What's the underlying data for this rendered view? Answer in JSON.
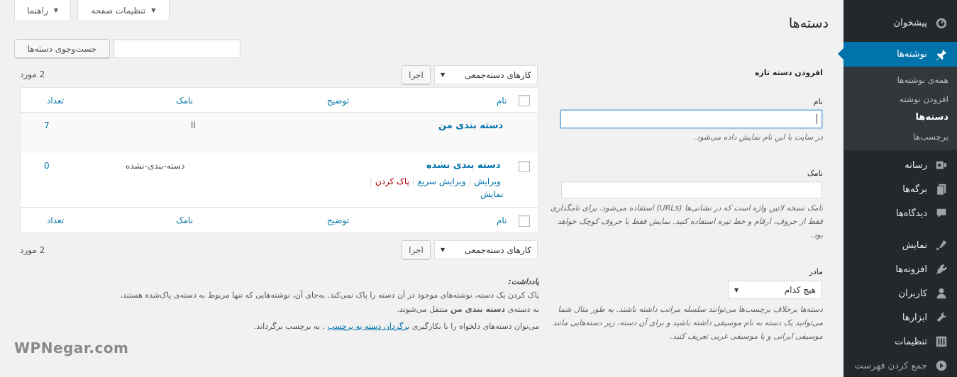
{
  "sidebar": {
    "items": [
      {
        "label": "پیشخوان",
        "icon": "dashboard-icon"
      },
      {
        "label": "نوشته‌ها",
        "icon": "pin-icon"
      },
      {
        "label": "رسانه",
        "icon": "media-icon"
      },
      {
        "label": "برگه‌ها",
        "icon": "pages-icon"
      },
      {
        "label": "دیدگاه‌ها",
        "icon": "comments-icon"
      },
      {
        "label": "نمایش",
        "icon": "appearance-icon"
      },
      {
        "label": "افزونه‌ها",
        "icon": "plugins-icon"
      },
      {
        "label": "کاربران",
        "icon": "users-icon"
      },
      {
        "label": "ابزارها",
        "icon": "tools-icon"
      },
      {
        "label": "تنظیمات",
        "icon": "settings-icon"
      },
      {
        "label": "جمع کردن فهرست",
        "icon": "collapse-icon"
      }
    ],
    "submenu": [
      "همه‌ی نوشته‌ها",
      "افزودن نوشته",
      "دسته‌ها",
      "برچسب‌ها"
    ]
  },
  "top": {
    "help": "راهنما",
    "screen_options": "تنظیمات صفحه"
  },
  "page_title": "دسته‌ها",
  "search": {
    "button": "جست‌وجوی دسته‌ها",
    "value": ""
  },
  "add_form": {
    "heading": "افزودن دسته تازه",
    "name_label": "نام",
    "name_desc": "در سایت با این نام نمایش داده می‌شود.",
    "slug_label": "نامک",
    "slug_desc": "نامک نسخه لاتین واژه است که در نشانی‌ها (URLs) استفاده می‌شود. برای نامگذاری فقط از حروف، ارقام و خط تیره استفاده کنید. نمایش فقط با حروف کوچک خواهد بود.",
    "parent_label": "مادر",
    "parent_value": "هیچ کدام",
    "parent_desc": "دسته‌ها برخلاف برچسب‌ها می‌توانند سلسله مراتب داشته باشند. به طور مثال شما می‌توانید یک دسته به نام موسیقی داشته باشید و برای آن دسته، زیر دسته‌هایی مانند موسیقی ایرانی و یا موسیقی غربی تعریف کنید."
  },
  "bulk": {
    "select": "کارهای دسته‌جمعی",
    "apply": "اجرا",
    "count": "2 مورد"
  },
  "table": {
    "headers": {
      "name": "نام",
      "description": "توضیح",
      "slug": "نامک",
      "count": "تعداد"
    },
    "rows": [
      {
        "name": "دسته بندی من",
        "description": "",
        "slug": "ll",
        "count": "7"
      },
      {
        "name": "دسته بندی نشده",
        "description": "",
        "slug": "دسته-بندی-نشده",
        "count": "0"
      }
    ],
    "row_actions": {
      "edit": "ویرایش",
      "quick_edit": "ویرایش سریع",
      "delete": "پاک کردن",
      "view": "نمایش"
    }
  },
  "note": {
    "title": "یادداشت:",
    "line1": "پاک کردن یک دسته، نوشته‌های موجود در آن دسته را پاک نمی‌کند. به‌جای آن، نوشته‌هایی که تنها مربوط به دسته‌ی پاک‌شده هستند،",
    "line2_pre": "به دسته‌ی",
    "line2_bold": "دسته بندی من",
    "line2_post": "منتقل می‌شوند.",
    "line3_pre": "می‌توان دسته‌های دلخواه را با بکارگیری",
    "line3_link": "برگردان دسته به برچسب",
    "line3_post": ". به برچسب برگرداند."
  },
  "watermark": "WPNegar.com",
  "colors": {
    "sidebar": "#23282d",
    "accent": "#0073aa",
    "link": "#0073aa",
    "delete": "#a00"
  }
}
